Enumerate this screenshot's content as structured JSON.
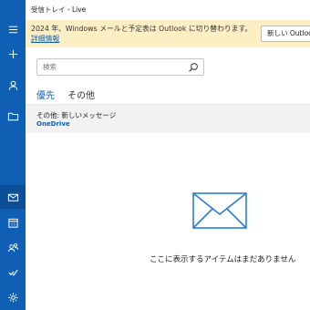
{
  "window": {
    "title": "受信トレイ - Live"
  },
  "banner": {
    "text": "2024 年、Windows メールと予定表は Outlook に切り替わります。",
    "link": "詳細情報",
    "button": "新しい Outlook を試す"
  },
  "search": {
    "placeholder": "検索"
  },
  "tabs": [
    {
      "label": "優先"
    },
    {
      "label": "その他"
    }
  ],
  "message": {
    "title": "その他: 新しいメッセージ",
    "sender": "OneDrive"
  },
  "empty_state": {
    "text": "ここに表示するアイテムはまだありません"
  },
  "rail": {
    "items": [
      {
        "icon": "hamburger-menu-icon"
      },
      {
        "icon": "plus-icon"
      },
      {
        "icon": "person-icon"
      },
      {
        "icon": "folder-icon"
      },
      {
        "icon": "mail-icon"
      },
      {
        "icon": "calendar-icon"
      },
      {
        "icon": "people-icon"
      },
      {
        "icon": "todo-check-icon"
      },
      {
        "icon": "gear-icon"
      }
    ]
  },
  "colors": {
    "accent": "#0f5fb5",
    "rail": "#0f5fb5",
    "banner": "#fdefc4",
    "selected_item": "#f2f2f2"
  }
}
